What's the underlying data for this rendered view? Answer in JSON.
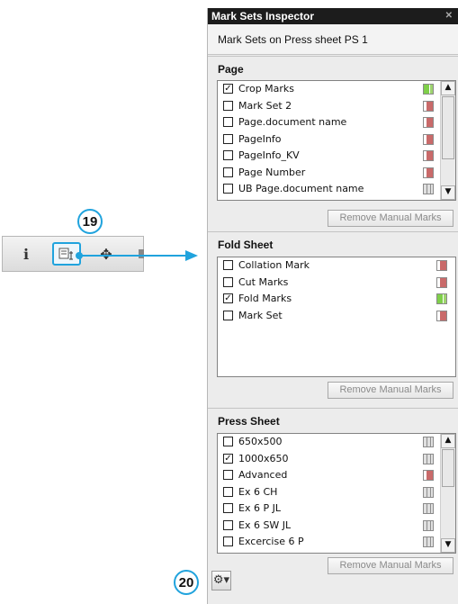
{
  "callouts": {
    "toolbar": "19",
    "bottom": "20"
  },
  "toolbar": {
    "icons": [
      "info-icon",
      "mark-inspector-icon",
      "move-icon",
      "more-icon"
    ],
    "info_glyph": "ℹ",
    "move_glyph": "✥"
  },
  "panel": {
    "title": "Mark Sets Inspector",
    "subtitle": "Mark Sets on Press sheet PS 1",
    "sections": [
      {
        "title": "Page",
        "button": "Remove Manual Marks",
        "items": [
          {
            "label": "Crop Marks",
            "checked": true,
            "status": "green"
          },
          {
            "label": "Mark Set 2",
            "checked": false,
            "status": "red"
          },
          {
            "label": "Page.document name",
            "checked": false,
            "status": "red"
          },
          {
            "label": "PageInfo",
            "checked": false,
            "status": "red"
          },
          {
            "label": "PageInfo_KV",
            "checked": false,
            "status": "red"
          },
          {
            "label": "Page Number",
            "checked": false,
            "status": "red"
          },
          {
            "label": "UB Page.document name",
            "checked": false,
            "status": "gray"
          }
        ]
      },
      {
        "title": "Fold Sheet",
        "button": "Remove Manual Marks",
        "items": [
          {
            "label": "Collation Mark",
            "checked": false,
            "status": "red"
          },
          {
            "label": "Cut Marks",
            "checked": false,
            "status": "red"
          },
          {
            "label": "Fold Marks",
            "checked": true,
            "status": "green"
          },
          {
            "label": "Mark Set",
            "checked": false,
            "status": "red"
          }
        ]
      },
      {
        "title": "Press Sheet",
        "button": "Remove Manual Marks",
        "items": [
          {
            "label": "650x500",
            "checked": false,
            "status": "gray"
          },
          {
            "label": "1000x650",
            "checked": true,
            "status": "gray"
          },
          {
            "label": "Advanced",
            "checked": false,
            "status": "red"
          },
          {
            "label": "Ex 6 CH",
            "checked": false,
            "status": "gray"
          },
          {
            "label": "Ex 6 P JL",
            "checked": false,
            "status": "gray"
          },
          {
            "label": "Ex 6 SW JL",
            "checked": false,
            "status": "gray"
          },
          {
            "label": "Excercise 6 P",
            "checked": false,
            "status": "gray"
          }
        ]
      }
    ]
  },
  "colors": {
    "accent": "#20a3dd",
    "status_green": "#7fcf4a",
    "status_red": "#c96a6a",
    "titlebar": "#1c1c1c"
  }
}
